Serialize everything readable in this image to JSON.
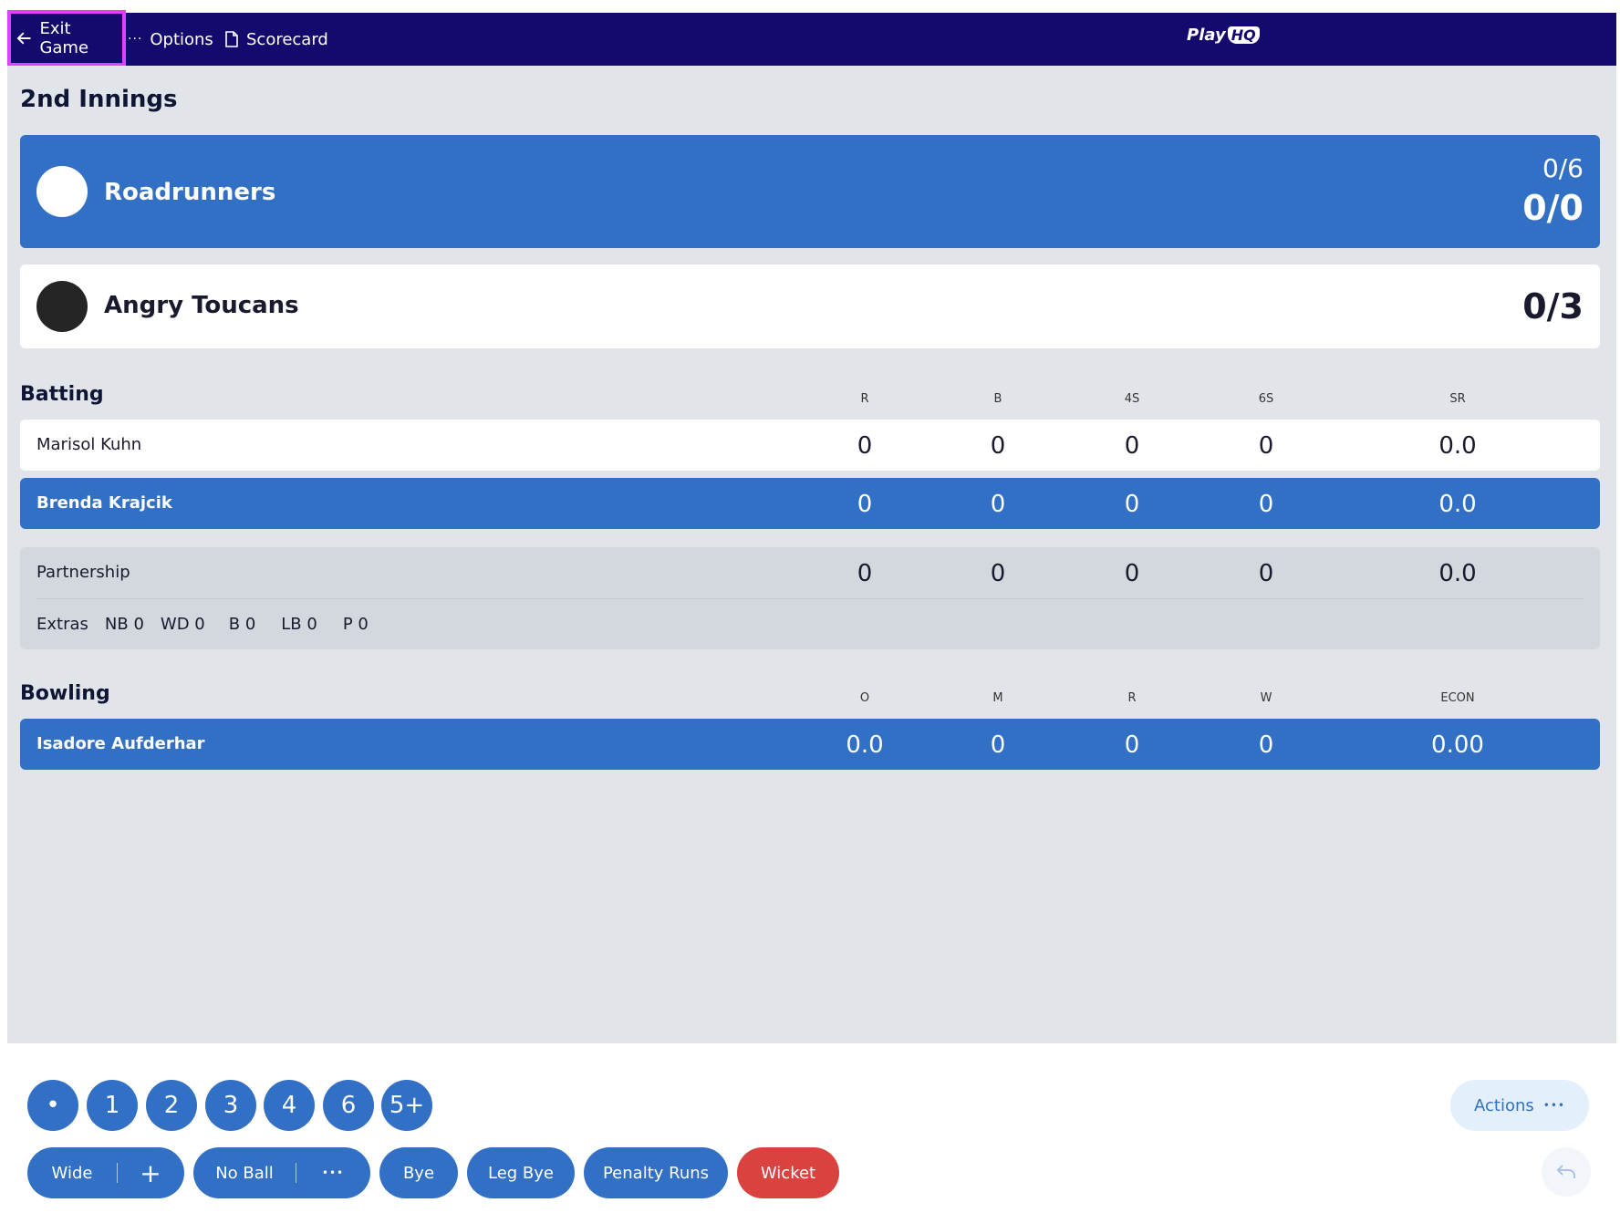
{
  "nav": {
    "exit_label": "Exit Game",
    "options_label": "Options",
    "scorecard_label": "Scorecard",
    "logo_text": "Play",
    "logo_badge": "HQ"
  },
  "innings_title": "2nd Innings",
  "teams": [
    {
      "name": "Roadrunners",
      "overs": "0/6",
      "score": "0/0",
      "highlighted": true
    },
    {
      "name": "Angry Toucans",
      "score": "0/3",
      "highlighted": false
    }
  ],
  "batting": {
    "title": "Batting",
    "columns": [
      "R",
      "B",
      "4S",
      "6S",
      "SR"
    ],
    "rows": [
      {
        "name": "Marisol Kuhn",
        "values": [
          "0",
          "0",
          "0",
          "0",
          "0.0"
        ]
      },
      {
        "name": "Brenda Krajcik",
        "values": [
          "0",
          "0",
          "0",
          "0",
          "0.0"
        ]
      }
    ],
    "partnership": {
      "name": "Partnership",
      "values": [
        "0",
        "0",
        "0",
        "0",
        "0.0"
      ]
    },
    "extras": {
      "label": "Extras",
      "items": [
        "NB 0",
        "WD 0",
        "B 0",
        "LB 0",
        "P 0"
      ]
    }
  },
  "bowling": {
    "title": "Bowling",
    "columns": [
      "O",
      "M",
      "R",
      "W",
      "ECON"
    ],
    "rows": [
      {
        "name": "Isadore Aufderhar",
        "values": [
          "0.0",
          "0",
          "0",
          "0",
          "0.00"
        ]
      }
    ]
  },
  "controls": {
    "runs": [
      "•",
      "1",
      "2",
      "3",
      "4",
      "6",
      "5+"
    ],
    "wide_label": "Wide",
    "wide_plus": "+",
    "noball_label": "No Ball",
    "noball_more": "•••",
    "bye_label": "Bye",
    "legbye_label": "Leg Bye",
    "penalty_label": "Penalty Runs",
    "wicket_label": "Wicket",
    "actions_label": "Actions",
    "actions_more": "•••"
  },
  "colors": {
    "nav_bg": "#140a6e",
    "primary": "#3170c5",
    "danger": "#d9423e",
    "page_bg": "#e1e5ea"
  }
}
